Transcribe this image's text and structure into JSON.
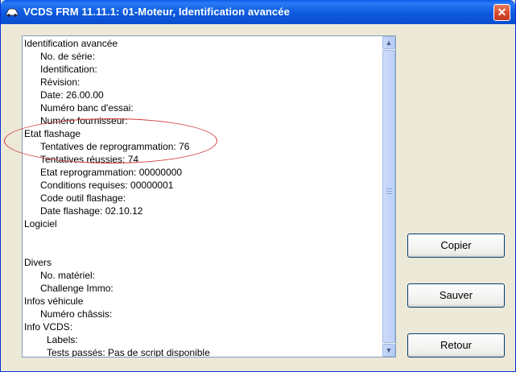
{
  "window": {
    "title": "VCDS FRM 11.11.1: 01-Moteur,  Identification avancée",
    "close_glyph": "✕",
    "app_icon": "car-icon"
  },
  "buttons": {
    "copy": "Copier",
    "save": "Sauver",
    "back": "Retour"
  },
  "lines": [
    {
      "text": "Identification avancée",
      "level": 0
    },
    {
      "text": "No. de série:",
      "level": 1
    },
    {
      "text": "Identification:",
      "level": 1
    },
    {
      "text": "Révision:",
      "level": 1
    },
    {
      "text": "Date: 26.00.00",
      "level": 1
    },
    {
      "text": "Numéro banc d'essai:",
      "level": 1
    },
    {
      "text": "Numéro fournisseur:",
      "level": 1
    },
    {
      "text": "Etat flashage",
      "level": 0
    },
    {
      "text": "Tentatives de reprogrammation: 76",
      "level": 1
    },
    {
      "text": "Tentatives réussies: 74",
      "level": 1
    },
    {
      "text": "Etat reprogrammation: 00000000",
      "level": 1
    },
    {
      "text": "Conditions requises: 00000001",
      "level": 1
    },
    {
      "text": "Code outil flashage:",
      "level": 1
    },
    {
      "text": "Date flashage: 02.10.12",
      "level": 1
    },
    {
      "text": "Logiciel",
      "level": 0
    },
    {
      "text": "",
      "level": 0
    },
    {
      "text": "",
      "level": 0
    },
    {
      "text": "Divers",
      "level": 0
    },
    {
      "text": "No. matériel:",
      "level": 1
    },
    {
      "text": "Challenge Immo:",
      "level": 1
    },
    {
      "text": "Infos véhicule",
      "level": 0
    },
    {
      "text": "Numéro châssis:",
      "level": 1
    },
    {
      "text": "Info VCDS:",
      "level": 0
    },
    {
      "text": "Labels:",
      "level": 2
    },
    {
      "text": "Tests passés: Pas de script disponible",
      "level": 2
    }
  ],
  "scrollbar": {
    "up_glyph": "▲",
    "down_glyph": "▼"
  },
  "annotation_color": "#d23b3b"
}
